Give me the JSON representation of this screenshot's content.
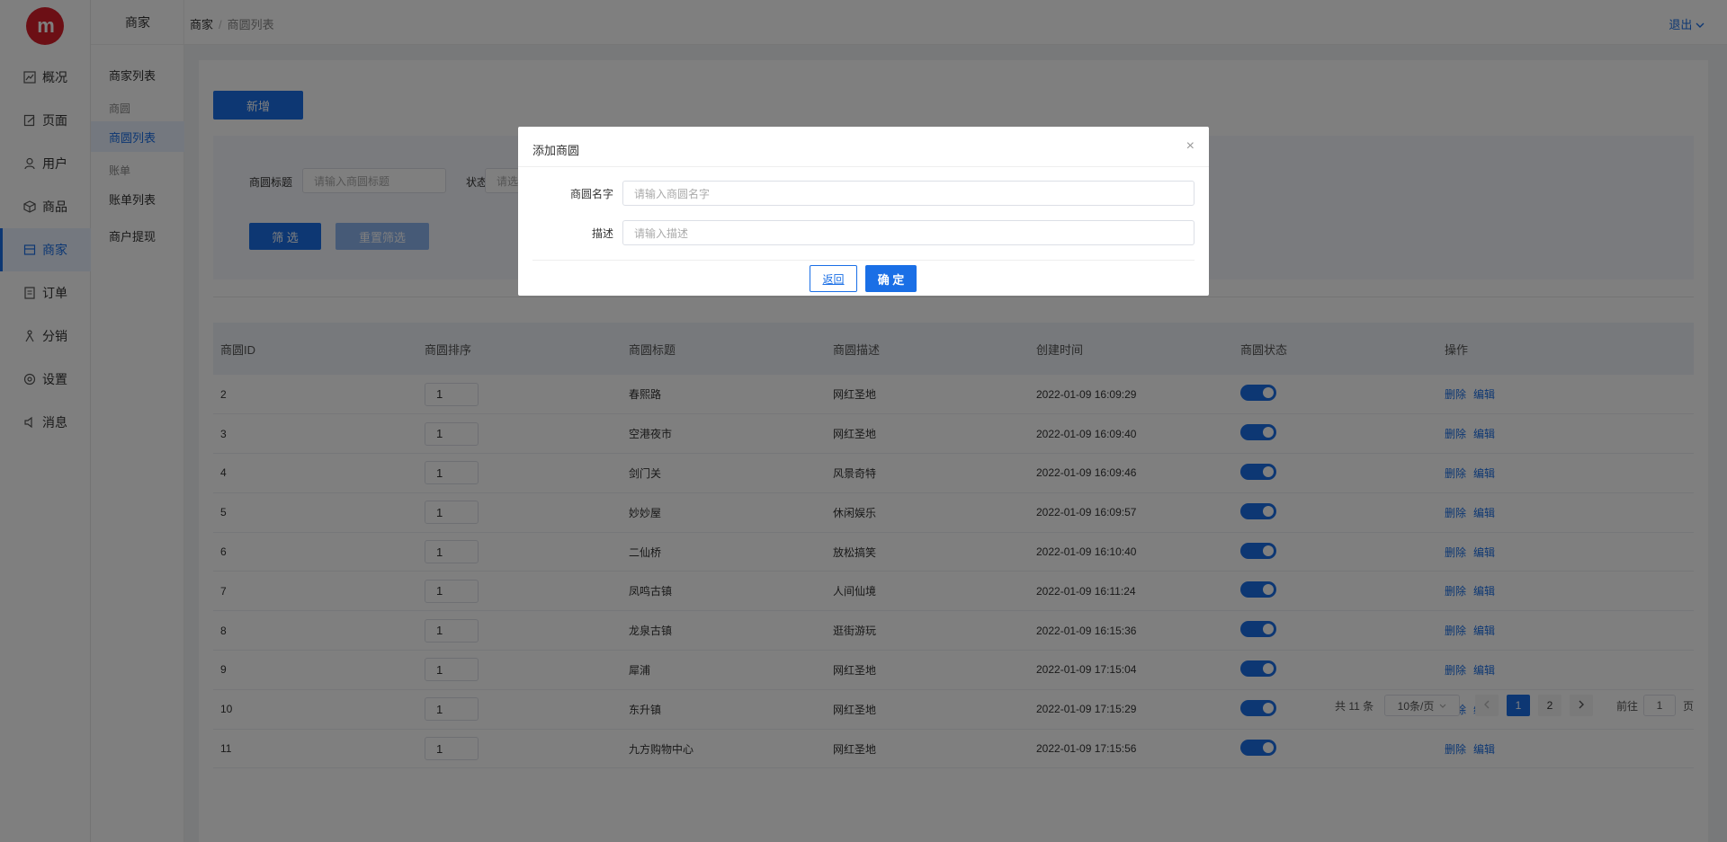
{
  "logo_text": "m",
  "nav": [
    {
      "label": "概况",
      "icon": "chart-line-icon"
    },
    {
      "label": "页面",
      "icon": "page-edit-icon"
    },
    {
      "label": "用户",
      "icon": "user-icon"
    },
    {
      "label": "商品",
      "icon": "cube-icon"
    },
    {
      "label": "商家",
      "icon": "store-icon",
      "active": true
    },
    {
      "label": "订单",
      "icon": "order-icon"
    },
    {
      "label": "分销",
      "icon": "distribution-icon"
    },
    {
      "label": "设置",
      "icon": "settings-icon"
    },
    {
      "label": "消息",
      "icon": "speaker-icon"
    }
  ],
  "subnav": {
    "title": "商家",
    "item_merchant_list": "商家列表",
    "group_park": "商圆",
    "item_park_list": "商圆列表",
    "group_bill": "账单",
    "item_bill_list": "账单列表",
    "item_withdraw": "商户提现"
  },
  "header": {
    "crumb_root": "商家",
    "crumb_sep": "/",
    "crumb_current": "商圆列表",
    "logout": "退出"
  },
  "toolbar": {
    "add_label": "新增"
  },
  "filter": {
    "title_label": "商圆标题",
    "title_placeholder": "请输入商圆标题",
    "status_label": "状态",
    "status_placeholder": "请选",
    "filter_btn": "筛 选",
    "reset_btn": "重置筛选"
  },
  "table": {
    "headers": [
      "商圆ID",
      "商圆排序",
      "商圆标题",
      "商圆描述",
      "创建时间",
      "商圆状态",
      "操作"
    ],
    "delete_label": "删除",
    "edit_label": "编辑",
    "rows": [
      {
        "id": "2",
        "sort": "1",
        "title": "春熙路",
        "desc": "网红圣地",
        "time": "2022-01-09 16:09:29",
        "enabled": true
      },
      {
        "id": "3",
        "sort": "1",
        "title": "空港夜市",
        "desc": "网红圣地",
        "time": "2022-01-09 16:09:40",
        "enabled": true
      },
      {
        "id": "4",
        "sort": "1",
        "title": "剑门关",
        "desc": "风景奇特",
        "time": "2022-01-09 16:09:46",
        "enabled": true
      },
      {
        "id": "5",
        "sort": "1",
        "title": "妙妙屋",
        "desc": "休闲娱乐",
        "time": "2022-01-09 16:09:57",
        "enabled": true
      },
      {
        "id": "6",
        "sort": "1",
        "title": "二仙桥",
        "desc": "放松搞笑",
        "time": "2022-01-09 16:10:40",
        "enabled": true
      },
      {
        "id": "7",
        "sort": "1",
        "title": "凤鸣古镇",
        "desc": "人间仙境",
        "time": "2022-01-09 16:11:24",
        "enabled": true
      },
      {
        "id": "8",
        "sort": "1",
        "title": "龙泉古镇",
        "desc": "逛街游玩",
        "time": "2022-01-09 16:15:36",
        "enabled": true
      },
      {
        "id": "9",
        "sort": "1",
        "title": "犀浦",
        "desc": "网红圣地",
        "time": "2022-01-09 17:15:04",
        "enabled": true
      },
      {
        "id": "10",
        "sort": "1",
        "title": "东升镇",
        "desc": "网红圣地",
        "time": "2022-01-09 17:15:29",
        "enabled": true
      },
      {
        "id": "11",
        "sort": "1",
        "title": "九方购物中心",
        "desc": "网红圣地",
        "time": "2022-01-09 17:15:56",
        "enabled": true
      }
    ]
  },
  "pagination": {
    "total": "共 11 条",
    "page_size": "10条/页",
    "pages": [
      "1",
      "2"
    ],
    "current": "1",
    "goto_label": "前往",
    "goto_value": "1",
    "goto_suffix": "页"
  },
  "modal": {
    "title": "添加商圆",
    "name_label": "商圆名字",
    "name_placeholder": "请输入商圆名字",
    "desc_label": "描述",
    "desc_placeholder": "请输入描述",
    "back_btn": "返回",
    "ok_btn": "确 定"
  },
  "colors": {
    "accent": "#1a6fe6",
    "logo": "#d81e2a"
  }
}
